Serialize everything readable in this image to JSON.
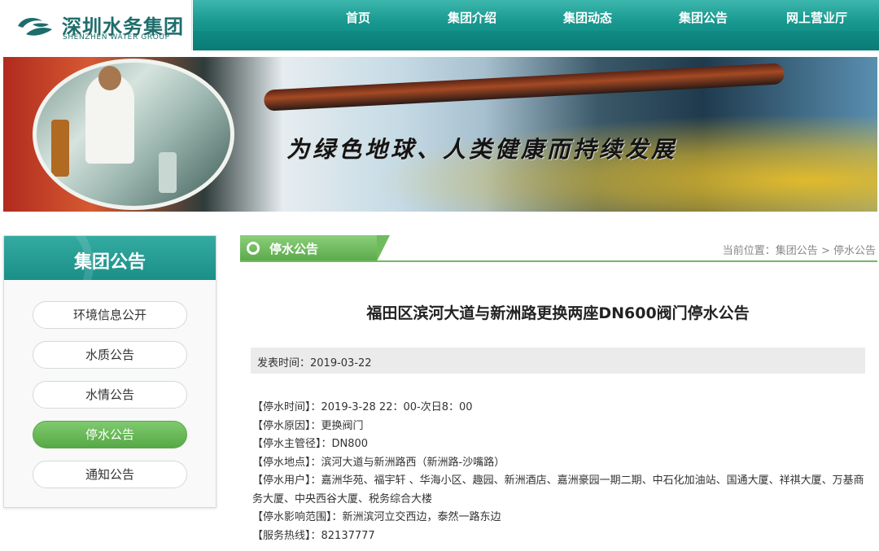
{
  "header": {
    "logo_cn": "深圳水务集团",
    "logo_en": "SHENZHEN WATER GROUP",
    "nav": [
      "首页",
      "集团介绍",
      "集团动态",
      "集团公告",
      "网上营业厅"
    ]
  },
  "banner": {
    "slogan": "为绿色地球、人类健康而持续发展"
  },
  "sidebar": {
    "title": "集团公告",
    "items": [
      "环境信息公开",
      "水质公告",
      "水情公告",
      "停水公告",
      "通知公告"
    ],
    "active_index": 3
  },
  "section": {
    "tab_label": "停水公告",
    "breadcrumb_prefix": "当前位置：",
    "breadcrumb_parent": "集团公告",
    "breadcrumb_sep": " > ",
    "breadcrumb_current": "停水公告"
  },
  "article": {
    "title": "福田区滨河大道与新洲路更换两座DN600阀门停水公告",
    "published": "发表时间：2019-03-22",
    "lines": [
      {
        "key": "【停水时间】",
        "value": "：2019-3-28  22：00-次日8：00"
      },
      {
        "key": "【停水原因】",
        "value": "：更换阀门"
      },
      {
        "key": "【停水主管径】",
        "value": "：DN800"
      },
      {
        "key": "【停水地点】",
        "value": "：滨河大道与新洲路西（新洲路-沙嘴路）"
      },
      {
        "key": "【停水用户】",
        "value": "：嘉洲华苑、福宇轩 、华海小区、趣园、新洲酒店、嘉洲豪园一期二期、中石化加油站、国通大厦、祥祺大厦、万基商务大厦、中央西谷大厦、税务综合大楼"
      },
      {
        "key": "【停水影响范围】",
        "value": "：新洲滨河立交西边，泰然一路东边"
      },
      {
        "key": "【服务热线】",
        "value": "：82137777"
      }
    ]
  },
  "colors": {
    "brand_teal": "#17978e",
    "accent_green": "#5aa94a"
  }
}
